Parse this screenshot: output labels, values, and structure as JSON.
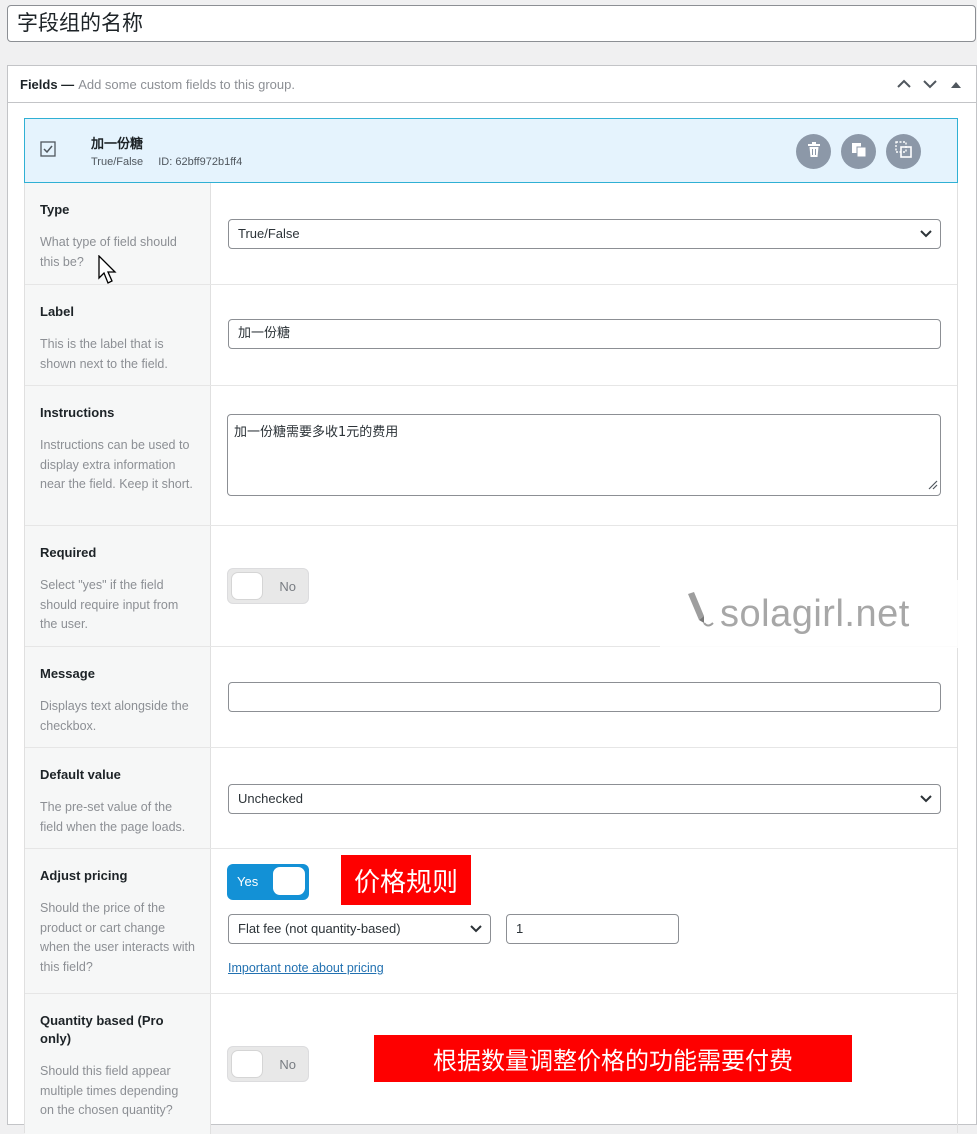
{
  "group_title": "字段组的名称",
  "fields_panel": {
    "heading": "Fields —",
    "description": "Add some custom fields to this group.",
    "controls": [
      "chevron-up-icon",
      "chevron-down-icon",
      "collapse-triangle-icon"
    ]
  },
  "field": {
    "name": "加一份糖",
    "type_label": "True/False",
    "id_text": "ID: 62bff972b1ff4",
    "actions": [
      "trash-icon",
      "copy-icon",
      "duplicate-icon"
    ]
  },
  "settings": {
    "type": {
      "label": "Type",
      "hint": "What type of field should this be?",
      "value": "True/False"
    },
    "label": {
      "label": "Label",
      "hint": "This is the label that is shown next to the field.",
      "value": "加一份糖"
    },
    "instructions": {
      "label": "Instructions",
      "hint": "Instructions can be used to display extra information near the field. Keep it short.",
      "value": "加一份糖需要多收1元的费用"
    },
    "required": {
      "label": "Required",
      "hint": "Select \"yes\" if the field should require input from the user.",
      "toggle": "No"
    },
    "message": {
      "label": "Message",
      "hint": "Displays text alongside the checkbox.",
      "value": ""
    },
    "default_value": {
      "label": "Default value",
      "hint": "The pre-set value of the field when the page loads.",
      "value": "Unchecked"
    },
    "adjust_pricing": {
      "label": "Adjust pricing",
      "hint": "Should the price of the product or cart change when the user interacts with this field?",
      "toggle": "Yes",
      "fee_type": "Flat fee (not quantity-based)",
      "amount": "1",
      "note_link": "Important note about pricing",
      "annotation": "价格规则"
    },
    "quantity_based": {
      "label": "Quantity based (Pro only)",
      "hint": "Should this field appear multiple times depending on the chosen quantity?",
      "toggle": "No",
      "annotation": "根据数量调整价格的功能需要付费"
    }
  },
  "watermark": "solagirl.net",
  "colors": {
    "accent": "#1391d6",
    "annotation_red": "#fe0000",
    "field_highlight": "#e5f3fd"
  }
}
